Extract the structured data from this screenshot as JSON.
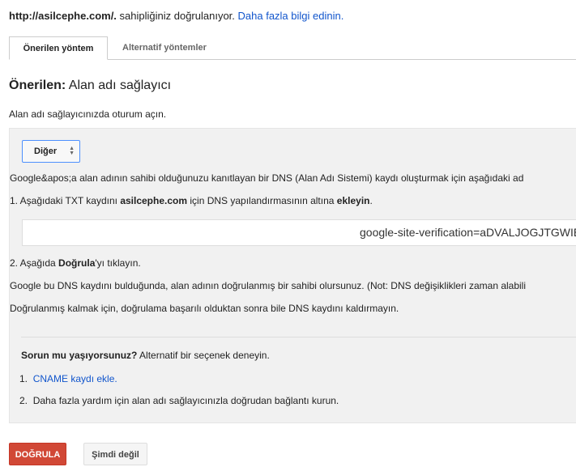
{
  "header": {
    "url": "http://asilcephe.com/.",
    "text": " sahipliğiniz doğrulanıyor. ",
    "link": "Daha fazla bilgi edinin."
  },
  "tabs": [
    {
      "label": "Önerilen yöntem",
      "active": true
    },
    {
      "label": "Alternatif yöntemler",
      "active": false
    }
  ],
  "heading": {
    "bold": "Önerilen:",
    "rest": " Alan adı sağlayıcı"
  },
  "intro": "Alan adı sağlayıcınızda oturum açın.",
  "provider_select": {
    "value": "Diğer"
  },
  "instructions": {
    "description": "Google&apos;a alan adının sahibi olduğunuzu kanıtlayan bir DNS (Alan Adı Sistemi) kaydı oluşturmak için aşağıdaki ad",
    "step1": {
      "a": "1. Aşağıdaki TXT kaydını ",
      "domain": "asilcephe.com",
      "b": " için DNS yapılandırmasının altına ",
      "action": "ekleyin",
      "c": "."
    },
    "txt_record": "google-site-verification=aDVALJOGJTGWIE",
    "step2": {
      "a": "2. Aşağıda ",
      "bold": "Doğrula",
      "b": "'yı tıklayın."
    },
    "note": "Google bu DNS kaydını bulduğunda, alan adının doğrulanmış bir sahibi olursunuz. (Not: DNS değişiklikleri zaman alabili",
    "keep": "Doğrulanmış kalmak için, doğrulama başarılı olduktan sonra bile DNS kaydını kaldırmayın."
  },
  "trouble": {
    "bold": "Sorun mu yaşıyorsunuz?",
    "rest": " Alternatif bir seçenek deneyin.",
    "items": [
      {
        "num": "1.",
        "text": "CNAME kaydı ekle."
      },
      {
        "num": "2.",
        "text": "Daha fazla yardım için alan adı sağlayıcınızla doğrudan bağlantı kurun."
      }
    ]
  },
  "buttons": {
    "verify": "DOĞRULA",
    "later": "Şimdi değil"
  },
  "colors": {
    "link": "#1155cc",
    "primary": "#d14836",
    "panel": "#f1f1f1",
    "focus": "#4d90fe"
  }
}
